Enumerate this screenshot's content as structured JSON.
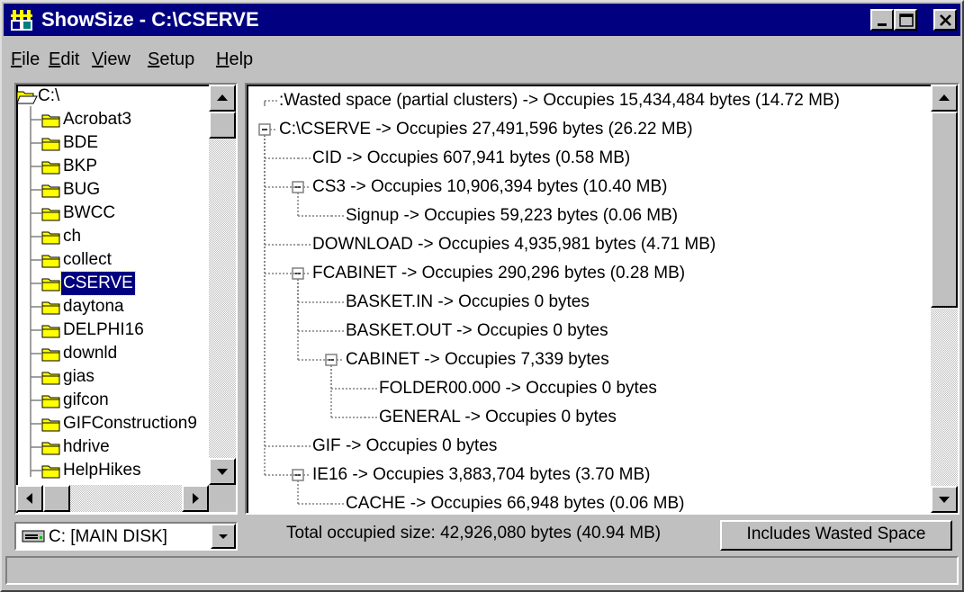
{
  "window": {
    "title": "ShowSize - C:\\CSERVE"
  },
  "menu": [
    {
      "label": "File",
      "u": "F",
      "rest": "ile"
    },
    {
      "label": "Edit",
      "u": "E",
      "rest": "dit"
    },
    {
      "label": "View",
      "u": "V",
      "rest": "iew"
    },
    {
      "label": "Setup",
      "u": "S",
      "rest": "etup"
    },
    {
      "label": "Help",
      "u": "H",
      "rest": "elp"
    }
  ],
  "dir_tree": {
    "root": "C:\\",
    "folders": [
      "Acrobat3",
      "BDE",
      "BKP",
      "BUG",
      "BWCC",
      "ch",
      "collect",
      "CSERVE",
      "daytona",
      "DELPHI16",
      "downld",
      "gias",
      "gifcon",
      "GIFConstruction9",
      "hdrive",
      "HelpHikes"
    ],
    "selected": "CSERVE"
  },
  "size_tree": [
    {
      "text": ":Wasted space (partial clusters) -> Occupies 15,434,484 bytes (14.72 MB)",
      "level": 0,
      "expander": "none"
    },
    {
      "text": "C:\\CSERVE -> Occupies 27,491,596 bytes (26.22 MB)",
      "level": 0,
      "expander": "minus"
    },
    {
      "text": "CID -> Occupies 607,941 bytes (0.58 MB)",
      "level": 1,
      "expander": "none"
    },
    {
      "text": "CS3 -> Occupies 10,906,394 bytes (10.40 MB)",
      "level": 1,
      "expander": "minus"
    },
    {
      "text": "Signup -> Occupies 59,223 bytes (0.06 MB)",
      "level": 2,
      "expander": "none"
    },
    {
      "text": "DOWNLOAD -> Occupies 4,935,981 bytes (4.71 MB)",
      "level": 1,
      "expander": "none"
    },
    {
      "text": "FCABINET -> Occupies 290,296 bytes (0.28 MB)",
      "level": 1,
      "expander": "minus"
    },
    {
      "text": "BASKET.IN -> Occupies 0 bytes",
      "level": 2,
      "expander": "none"
    },
    {
      "text": "BASKET.OUT -> Occupies 0 bytes",
      "level": 2,
      "expander": "none"
    },
    {
      "text": "CABINET -> Occupies 7,339 bytes",
      "level": 2,
      "expander": "minus"
    },
    {
      "text": "FOLDER00.000 -> Occupies 0 bytes",
      "level": 3,
      "expander": "none"
    },
    {
      "text": "GENERAL -> Occupies 0 bytes",
      "level": 3,
      "expander": "none"
    },
    {
      "text": "GIF -> Occupies 0 bytes",
      "level": 1,
      "expander": "none"
    },
    {
      "text": "IE16 -> Occupies 3,883,704 bytes (3.70 MB)",
      "level": 1,
      "expander": "minus"
    },
    {
      "text": "CACHE -> Occupies 66,948 bytes (0.06 MB)",
      "level": 2,
      "expander": "none"
    }
  ],
  "drive": {
    "label": "C: [MAIN DISK]"
  },
  "total": {
    "text": "Total occupied size: 42,926,080 bytes (40.94 MB)"
  },
  "wasted_button": {
    "label": "Includes Wasted Space"
  },
  "status": {
    "text": ""
  }
}
